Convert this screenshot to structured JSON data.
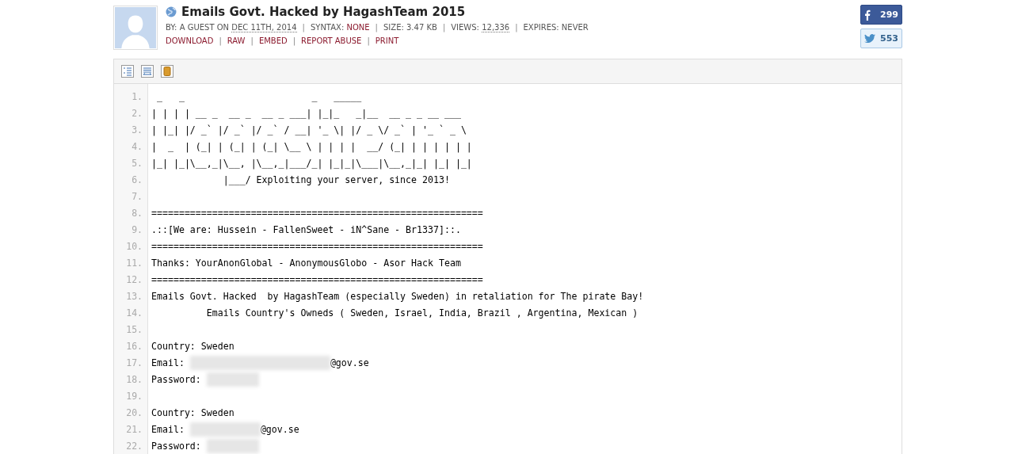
{
  "paste": {
    "title": "Emails Govt. Hacked by HagashTeam 2015",
    "meta": [
      {
        "kind": "plain",
        "text": "BY: A GUEST ON "
      },
      {
        "kind": "dotted",
        "text": "DEC 11TH, 2014"
      },
      {
        "kind": "sep",
        "text": "|"
      },
      {
        "kind": "plain",
        "text": "SYNTAX: "
      },
      {
        "kind": "link",
        "text": "NONE"
      },
      {
        "kind": "sep",
        "text": "|"
      },
      {
        "kind": "plain",
        "text": "SIZE: 3.47 KB"
      },
      {
        "kind": "sep",
        "text": "|"
      },
      {
        "kind": "plain",
        "text": "VIEWS: "
      },
      {
        "kind": "dotted",
        "text": "12,336"
      },
      {
        "kind": "sep",
        "text": "|"
      },
      {
        "kind": "plain",
        "text": "EXPIRES: NEVER"
      }
    ],
    "actions": [
      {
        "kind": "link",
        "text": "DOWNLOAD"
      },
      {
        "kind": "sep",
        "text": "|"
      },
      {
        "kind": "link",
        "text": "RAW"
      },
      {
        "kind": "sep",
        "text": "|"
      },
      {
        "kind": "link",
        "text": "EMBED"
      },
      {
        "kind": "sep",
        "text": "|"
      },
      {
        "kind": "link",
        "text": "REPORT ABUSE"
      },
      {
        "kind": "sep",
        "text": "|"
      },
      {
        "kind": "link",
        "text": "PRINT"
      }
    ]
  },
  "share": [
    {
      "kind": "facebook",
      "count": "299"
    },
    {
      "kind": "twitter",
      "count": "553"
    }
  ],
  "code": {
    "lines": [
      {
        "number": "1.",
        "parts": [
          {
            "kind": "text",
            "text": " _   _                       _   _____"
          }
        ]
      },
      {
        "number": "2.",
        "parts": [
          {
            "kind": "text",
            "text": "| | | | __ _  __ _  __ _ ___| |_|_   _|__  __ _ _ __ ___"
          }
        ]
      },
      {
        "number": "3.",
        "parts": [
          {
            "kind": "text",
            "text": "| |_| |/ _` |/ _` |/ _` / __| '_ \\| |/ _ \\/ _` | '_ ` _ \\"
          }
        ]
      },
      {
        "number": "4.",
        "parts": [
          {
            "kind": "text",
            "text": "|  _  | (_| | (_| | (_| \\__ \\ | | | |  __/ (_| | | | | | |"
          }
        ]
      },
      {
        "number": "5.",
        "parts": [
          {
            "kind": "text",
            "text": "|_| |_|\\__,_|\\__, |\\__,_|___/_| |_|_|\\___|\\__,_|_| |_| |_|"
          }
        ]
      },
      {
        "number": "6.",
        "parts": [
          {
            "kind": "text",
            "text": "             |___/ Exploiting your server, since 2013!"
          }
        ]
      },
      {
        "number": "7."
      },
      {
        "number": "8.",
        "parts": [
          {
            "kind": "text",
            "text": "============================================================"
          }
        ]
      },
      {
        "number": "9.",
        "parts": [
          {
            "kind": "text",
            "text": ".::[We are: Hussein - FallenSweet - iN^Sane - Br1337]::."
          }
        ]
      },
      {
        "number": "10.",
        "parts": [
          {
            "kind": "text",
            "text": "============================================================"
          }
        ]
      },
      {
        "number": "11.",
        "parts": [
          {
            "kind": "text",
            "text": "Thanks: YourAnonGlobal - AnonymousGlobo - Asor Hack Team"
          }
        ]
      },
      {
        "number": "12.",
        "parts": [
          {
            "kind": "text",
            "text": "============================================================"
          }
        ]
      },
      {
        "number": "13.",
        "parts": [
          {
            "kind": "text",
            "text": "Emails Govt. Hacked  by HagashTeam (especially Sweden) in retaliation for The pirate Bay!"
          }
        ]
      },
      {
        "number": "14.",
        "parts": [
          {
            "kind": "text",
            "text": "          Emails Country's Owneds ( Sweden, Israel, India, Brazil , Argentina, Mexican )"
          }
        ]
      },
      {
        "number": "15."
      },
      {
        "number": "16.",
        "parts": [
          {
            "kind": "text",
            "text": "Country: Sweden"
          }
        ]
      },
      {
        "number": "17.",
        "parts": [
          {
            "kind": "text",
            "text": "Email: "
          },
          {
            "kind": "blur-long"
          },
          {
            "kind": "text",
            "text": "@gov.se"
          }
        ]
      },
      {
        "number": "18.",
        "parts": [
          {
            "kind": "text",
            "text": "Password: "
          },
          {
            "kind": "blur-short"
          }
        ]
      },
      {
        "number": "19."
      },
      {
        "number": "20.",
        "parts": [
          {
            "kind": "text",
            "text": "Country: Sweden"
          }
        ]
      },
      {
        "number": "21.",
        "parts": [
          {
            "kind": "text",
            "text": "Email: "
          },
          {
            "kind": "blur-medium"
          },
          {
            "kind": "text",
            "text": "@gov.se"
          }
        ]
      },
      {
        "number": "22.",
        "parts": [
          {
            "kind": "text",
            "text": "Password: "
          },
          {
            "kind": "blur-short"
          }
        ]
      }
    ]
  }
}
